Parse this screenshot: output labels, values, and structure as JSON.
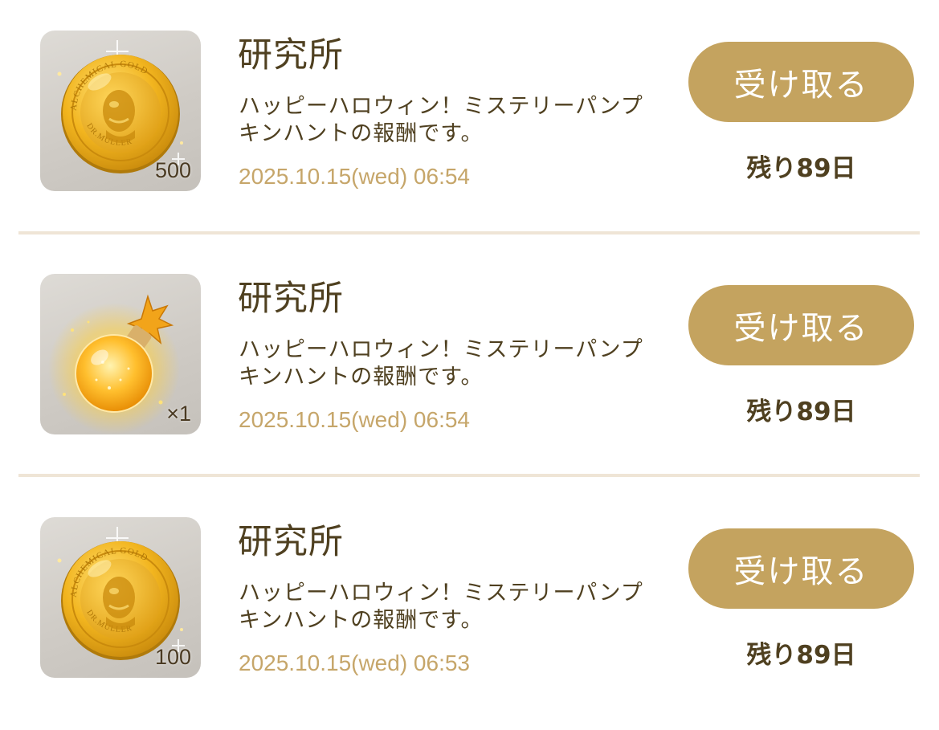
{
  "mail_items": [
    {
      "reward_icon": "gold-coin-icon",
      "quantity": "500",
      "title": "研究所",
      "message_line1": "ハッピーハロウィン！ミステリーパンプ",
      "message_line2": "キンハントの報酬です。",
      "date": "2025.10.15(wed) 06:54",
      "claim_label": "受け取る",
      "remaining": "残り89日"
    },
    {
      "reward_icon": "potion-flask-icon",
      "quantity": "×1",
      "title": "研究所",
      "message_line1": "ハッピーハロウィン！ミステリーパンプ",
      "message_line2": "キンハントの報酬です。",
      "date": "2025.10.15(wed) 06:54",
      "claim_label": "受け取る",
      "remaining": "残り89日"
    },
    {
      "reward_icon": "gold-coin-icon",
      "quantity": "100",
      "title": "研究所",
      "message_line1": "ハッピーハロウィン！ミステリーパンプ",
      "message_line2": "キンハントの報酬です。",
      "date": "2025.10.15(wed) 06:53",
      "claim_label": "受け取る",
      "remaining": "残り89日"
    }
  ],
  "coin_engraving": {
    "top_text": "ALCHEMICAL GOLD",
    "bottom_text": "DR.MULLER"
  },
  "colors": {
    "button": "#c4a35f",
    "title_text": "#4f4020",
    "date_text": "#c6a66a",
    "divider": "#efe5d6"
  }
}
